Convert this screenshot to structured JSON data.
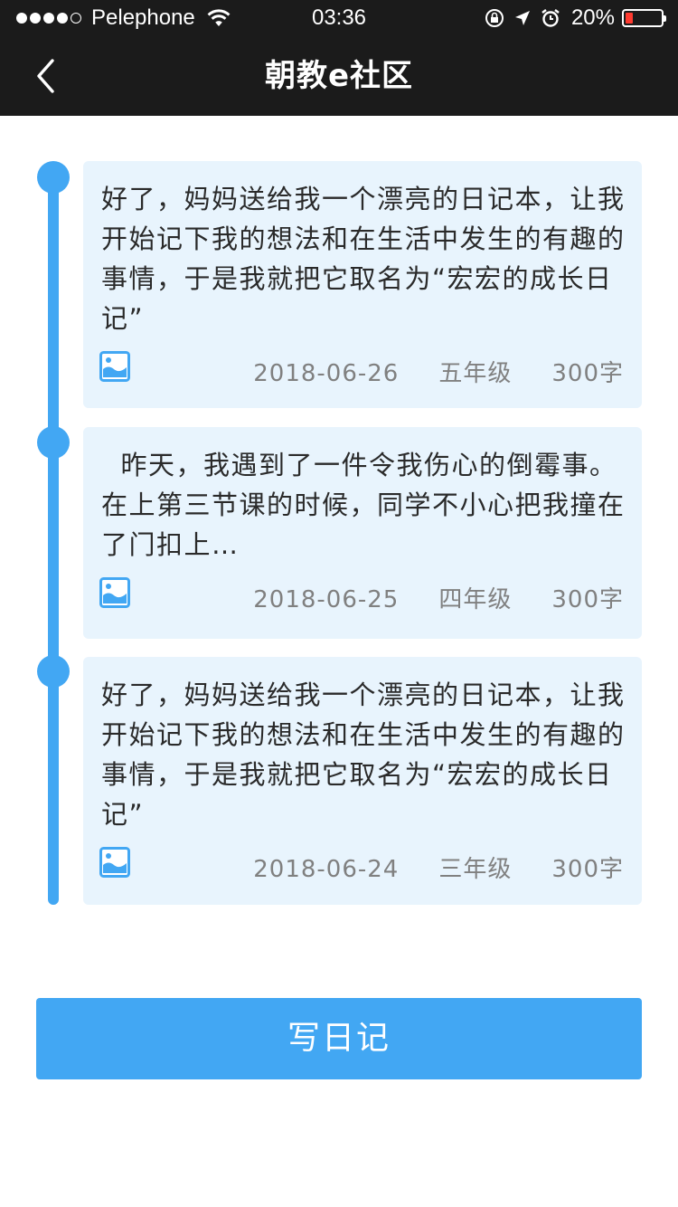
{
  "status_bar": {
    "carrier": "Pelephone",
    "time": "03:36",
    "battery_percent": "20%",
    "battery_level": 0.2,
    "signal_bars_filled": 4,
    "signal_bars_total": 5
  },
  "nav": {
    "title": "朝教e社区",
    "back_icon": "chevron-left-icon"
  },
  "colors": {
    "accent": "#42a7f3",
    "card_bg": "#e8f4fd",
    "bar_bg": "#1b1b1b",
    "battery_low": "#ff3b30"
  },
  "entries": [
    {
      "text": "好了，妈妈送给我一个漂亮的日记本，让我开始记下我的想法和在生活中发生的有趣的事情，于是我就把它取名为“宏宏的成长日记”",
      "date": "2018-06-26",
      "grade": "五年级",
      "word_count": "300字",
      "icon": "image-icon"
    },
    {
      "text": "  昨天，我遇到了一件令我伤心的倒霉事。在上第三节课的时候，同学不小心把我撞在了门扣上…",
      "date": "2018-06-25",
      "grade": "四年级",
      "word_count": "300字",
      "icon": "image-icon"
    },
    {
      "text": "好了，妈妈送给我一个漂亮的日记本，让我开始记下我的想法和在生活中发生的有趣的事情，于是我就把它取名为“宏宏的成长日记”",
      "date": "2018-06-24",
      "grade": "三年级",
      "word_count": "300字",
      "icon": "image-icon"
    }
  ],
  "write_button": {
    "label": "写日记"
  }
}
